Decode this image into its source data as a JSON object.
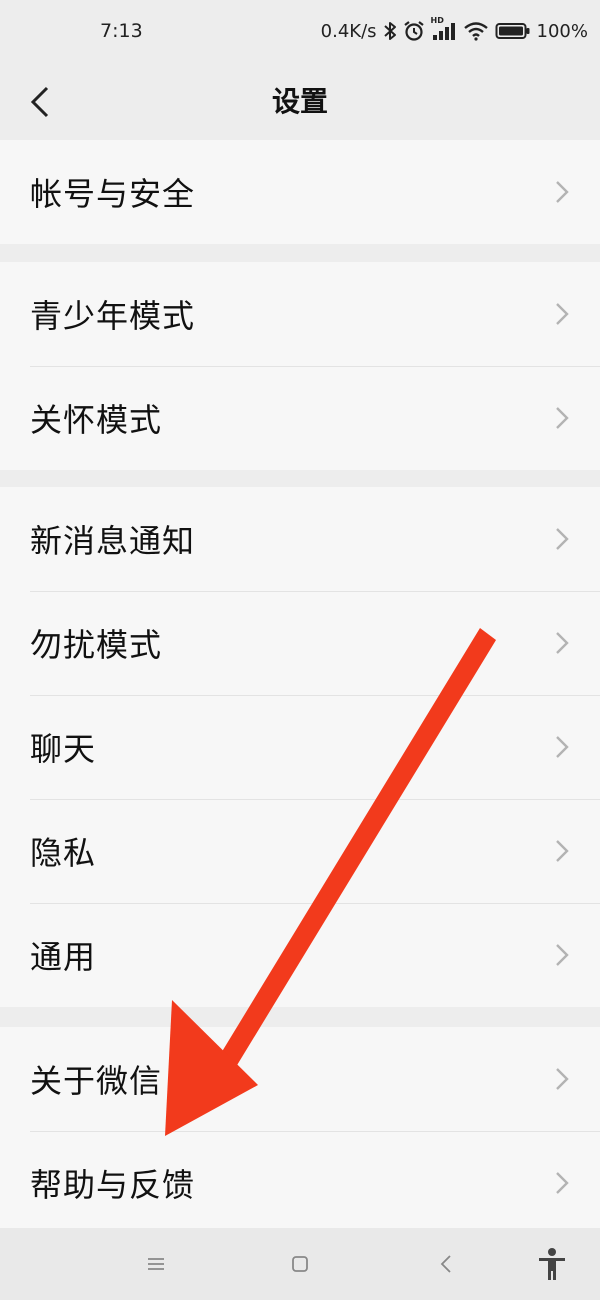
{
  "status_bar": {
    "time": "7:13",
    "net_speed": "0.4K/s",
    "network_badge": "HD",
    "battery": "100%"
  },
  "nav": {
    "title": "设置"
  },
  "groups": [
    {
      "items": [
        {
          "label": "帐号与安全"
        }
      ]
    },
    {
      "items": [
        {
          "label": "青少年模式"
        },
        {
          "label": "关怀模式"
        }
      ]
    },
    {
      "items": [
        {
          "label": "新消息通知"
        },
        {
          "label": "勿扰模式"
        },
        {
          "label": "聊天"
        },
        {
          "label": "隐私"
        },
        {
          "label": "通用"
        }
      ]
    },
    {
      "items": [
        {
          "label": "关于微信"
        },
        {
          "label": "帮助与反馈"
        }
      ]
    }
  ],
  "annotation": {
    "color": "#f23a1c"
  },
  "colors": {
    "page_bg": "#ededed",
    "row_bg": "#f7f7f7",
    "chevron": "#b3b3b3"
  }
}
